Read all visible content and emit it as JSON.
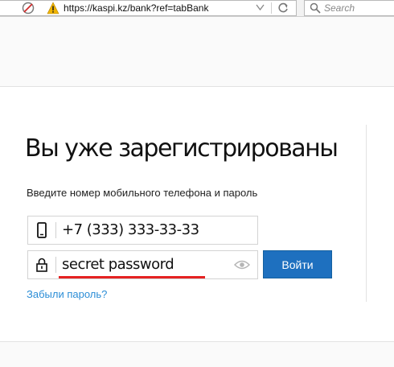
{
  "browser": {
    "url": "https://kaspi.kz/bank?ref=tabBank",
    "search_placeholder": "Search"
  },
  "login": {
    "title": "Вы уже зарегистрированы",
    "subtitle": "Введите номер мобильного телефона и пароль",
    "phone_value": "+7 (333) 333-33-33",
    "password_value": "secret password",
    "login_button": "Войти",
    "forgot_link": "Забыли пароль?"
  },
  "icons": {
    "site": "blocked-site-icon",
    "warning": "warning-icon",
    "dropdown": "dropdown-arrow-icon",
    "reload": "reload-icon",
    "search": "search-icon",
    "phone": "phone-icon",
    "lock": "lock-icon",
    "eye": "eye-icon"
  },
  "colors": {
    "accent": "#1e70bf",
    "link": "#2b8dd6",
    "highlight": "#e52222",
    "warning": "#f0b400"
  }
}
